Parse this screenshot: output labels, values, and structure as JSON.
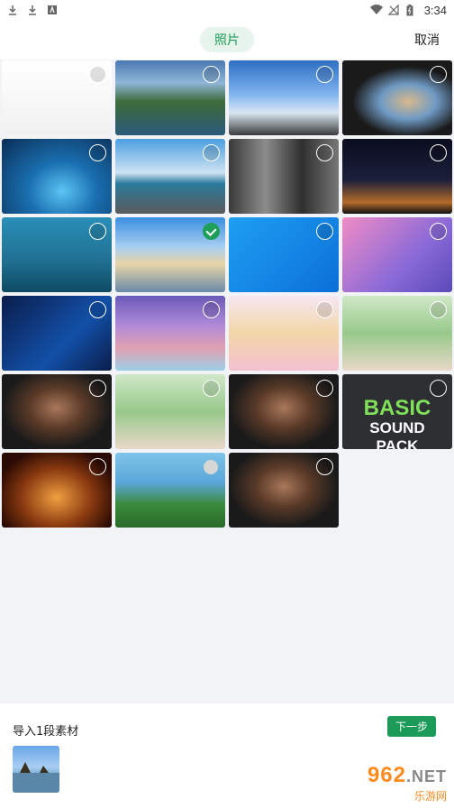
{
  "status_bar": {
    "time": "3:34",
    "left_icons": [
      "download-icon",
      "download-icon",
      "app-icon"
    ],
    "right_icons": [
      "wifi-icon",
      "no-signal-icon",
      "battery-icon"
    ]
  },
  "header": {
    "tab_label": "照片",
    "cancel_label": "取消"
  },
  "grid": {
    "items": [
      {
        "name": "profile-screenshot",
        "checked": false,
        "bg": "linear-gradient(#ffffff,#f0f0f0)"
      },
      {
        "name": "mountain-lake",
        "checked": false,
        "bg": "linear-gradient(#4a78b0 0%, #8fb6d8 30%, #3d6b3a 55%, #2b5a7a 100%)"
      },
      {
        "name": "sea-of-clouds",
        "checked": false,
        "bg": "linear-gradient(#2f6fc2 0%, #7eb3ef 45%, #d9e6f2 70%, #3a3a3a 100%)"
      },
      {
        "name": "beach-cave",
        "checked": false,
        "bg": "radial-gradient(ellipse at 60% 55%, #d7b98c 0%, #6f9ac4 30%, #1a1a1a 60%)"
      },
      {
        "name": "ice-cave",
        "checked": false,
        "bg": "radial-gradient(ellipse at 55% 70%, #5bc5f3 0%, #1a6fb0 40%, #0a2d55 100%)"
      },
      {
        "name": "sky-bridge",
        "checked": false,
        "bg": "linear-gradient(#4a9ee0 0%, #cfe3f2 45%, #2a7a9c 60%, #5b5b5b 100%)"
      },
      {
        "name": "waterfall-cliff",
        "checked": false,
        "bg": "linear-gradient(90deg,#3a3a3a,#8c8c8c,#2f2f2f,#777)"
      },
      {
        "name": "milky-way",
        "checked": false,
        "bg": "linear-gradient(#0a0d1e 0%, #1b1f3b 55%, #b46a2a 85%, #101010 100%)"
      },
      {
        "name": "underwater-diver",
        "checked": false,
        "bg": "linear-gradient(#2a8fb8 0%, #1f6f90 60%, #0f4a63 100%)"
      },
      {
        "name": "beach-rocks",
        "checked": true,
        "bg": "linear-gradient(#3a8ee0 0%, #a8cff2 40%, #e8d4a8 62%, #6a8aa8 100%)"
      },
      {
        "name": "windows10-blue",
        "checked": false,
        "bg": "linear-gradient(135deg,#1e9ff2 0%, #0b6fd8 100%)"
      },
      {
        "name": "windows11-purple",
        "checked": false,
        "bg": "linear-gradient(135deg,#f08cc4 0%, #8a6ad8 60%, #5a4ab8 100%)"
      },
      {
        "name": "windows10-dark",
        "checked": false,
        "bg": "linear-gradient(135deg,#0a1d4a 0%, #1250a8 60%, #0a1d4a 100%)"
      },
      {
        "name": "anime-dragon-boat",
        "checked": false,
        "bg": "linear-gradient(#6a5ab8 0%, #b08ad8 40%, #e0a0b0 70%, #9ad0e8 100%)"
      },
      {
        "name": "anime-girl-yellow",
        "checked": false,
        "bg": "linear-gradient(#f6e7f3 0%, #f2d6a8 50%, #f3c0d0 100%)"
      },
      {
        "name": "woman-crown-green",
        "checked": false,
        "bg": "linear-gradient(#cfe8c8 0%, #98c98a 50%, #e8d8c8 100%)"
      },
      {
        "name": "woman-portrait-1",
        "checked": false,
        "bg": "radial-gradient(ellipse at 50% 45%, #a9785a 0%, #5a3a28 35%, #1a1a1a 70%)"
      },
      {
        "name": "woman-crown-green-2",
        "checked": false,
        "bg": "linear-gradient(#cfe8c8 0%, #98c98a 50%, #e8d8c8 100%)"
      },
      {
        "name": "woman-portrait-2",
        "checked": false,
        "bg": "radial-gradient(ellipse at 50% 45%, #a9785a 0%, #5a3a28 35%, #1a1a1a 70%)"
      },
      {
        "name": "basic-sound-pack",
        "checked": false,
        "bg": "#2d2f33",
        "text": [
          "BASIC",
          "SOUND",
          "PACK"
        ]
      },
      {
        "name": "microphone",
        "checked": false,
        "bg": "radial-gradient(ellipse at 50% 60%, #f0a040 0%, #8a3a10 45%, #2a0a04 80%)"
      },
      {
        "name": "smurf",
        "checked": false,
        "badge": true,
        "bg": "linear-gradient(#7fc4e8 0%, #5aa6d8 40%, #3a8a3a 70%, #2a6a2a 100%)"
      },
      {
        "name": "woman-portrait-3",
        "checked": false,
        "bg": "radial-gradient(ellipse at 50% 45%, #a9785a 0%, #5a3a28 35%, #1a1a1a 70%)"
      }
    ]
  },
  "bottom": {
    "import_label": "导入1段素材",
    "next_label": "下一步"
  },
  "watermark": {
    "main": "962",
    "net": ".NET",
    "sub": "乐游网"
  },
  "colors": {
    "accent_green": "#1b9b57",
    "watermark_orange": "#ff8a1e"
  }
}
